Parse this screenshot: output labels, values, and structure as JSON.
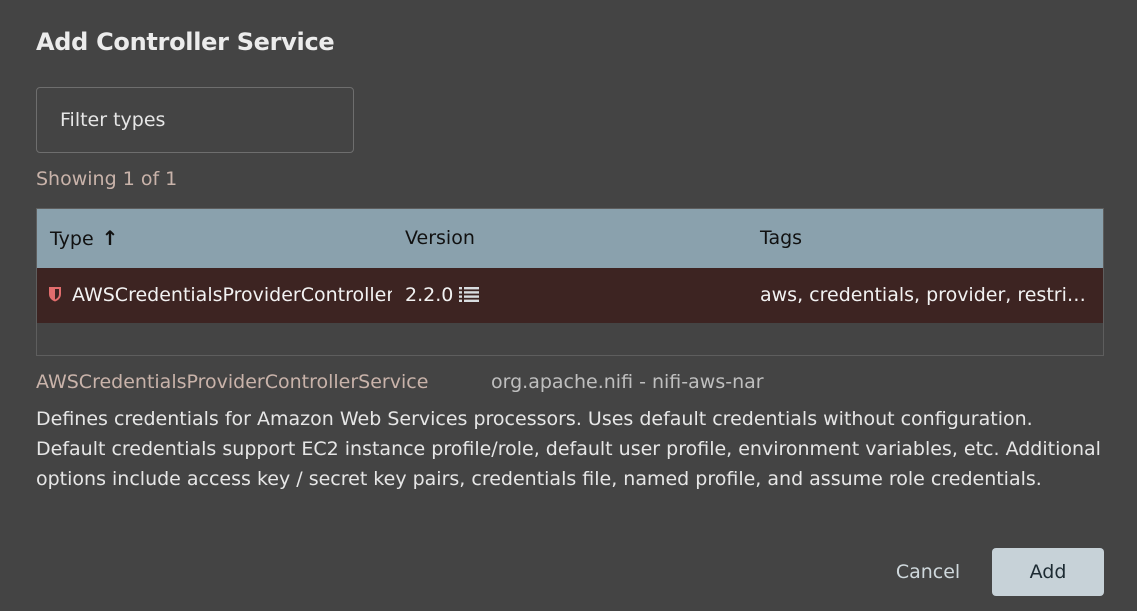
{
  "dialog": {
    "title": "Add Controller Service"
  },
  "filter": {
    "placeholder": "Filter types",
    "value": ""
  },
  "results": {
    "showing_text": "Showing 1 of 1"
  },
  "table": {
    "columns": {
      "type": "Type",
      "type_sort_icon": "arrow-up-icon",
      "version": "Version",
      "tags": "Tags"
    },
    "rows": [
      {
        "type": "AWSCredentialsProviderControllerService",
        "type_icon": "restricted-shield-icon",
        "version": "2.2.0",
        "version_icon": "bundle-list-icon",
        "tags": "aws, credentials, provider, restricted"
      }
    ]
  },
  "details": {
    "name": "AWSCredentialsProviderControllerService",
    "bundle": "org.apache.nifi - nifi-aws-nar",
    "description": "Defines credentials for Amazon Web Services processors. Uses default credentials without configuration. Default credentials support EC2 instance profile/role, default user profile, environment variables, etc. Additional options include access key / secret key pairs, credentials file, named profile, and assume role credentials."
  },
  "actions": {
    "cancel_label": "Cancel",
    "add_label": "Add"
  },
  "colors": {
    "background": "#444444",
    "header_row": "#8aa1ad",
    "selected_row": "#3d2422",
    "restricted_icon": "#e26d6d",
    "muted_text": "#c9b3aa",
    "add_button": "#c7d2d8"
  }
}
